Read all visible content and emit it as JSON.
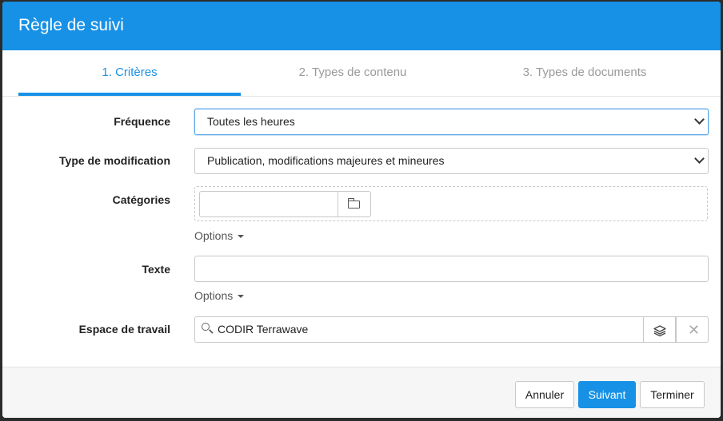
{
  "dialog": {
    "title": "Règle de suivi"
  },
  "tabs": [
    {
      "label": "1. Critères",
      "active": true
    },
    {
      "label": "2. Types de contenu",
      "active": false
    },
    {
      "label": "3. Types de documents",
      "active": false
    }
  ],
  "form": {
    "frequence": {
      "label": "Fréquence",
      "value": "Toutes les heures"
    },
    "type_modification": {
      "label": "Type de modification",
      "value": "Publication, modifications majeures et mineures"
    },
    "categories": {
      "label": "Catégories",
      "value": "",
      "options_label": "Options"
    },
    "texte": {
      "label": "Texte",
      "value": "",
      "options_label": "Options"
    },
    "espace_travail": {
      "label": "Espace de travail",
      "value": "CODIR Terrawave"
    }
  },
  "footer": {
    "cancel_label": "Annuler",
    "next_label": "Suivant",
    "finish_label": "Terminer"
  },
  "icons": {
    "folder": "folder-icon",
    "search": "search-icon",
    "layers": "layers-icon",
    "clear": "close-icon",
    "chevron": "chevron-down-icon"
  },
  "colors": {
    "accent": "#1791e6"
  }
}
